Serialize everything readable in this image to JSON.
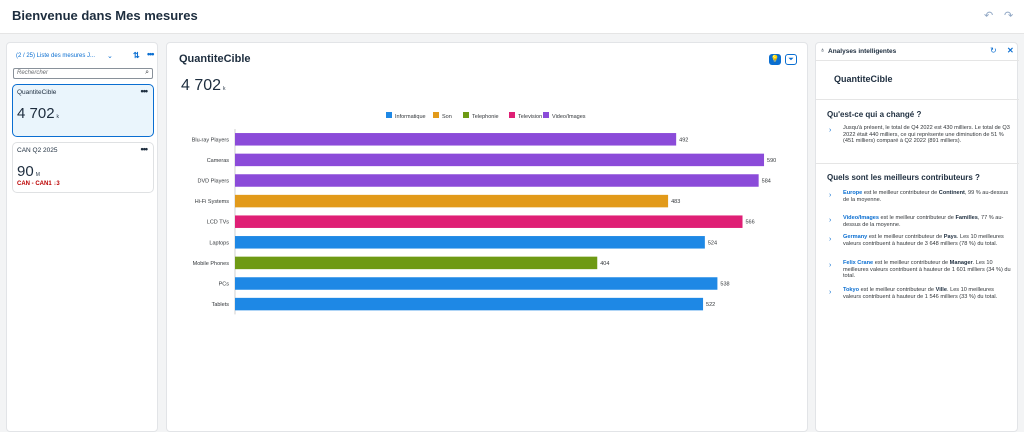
{
  "header": {
    "title": "Bienvenue dans Mes mesures"
  },
  "list": {
    "title": "(2 / 25) Liste des mesures J...",
    "search_placeholder": "Rechercher",
    "cards": [
      {
        "name": "QuantiteCible",
        "value": "4 702",
        "unit": "k"
      },
      {
        "name": "CAN Q2 2025",
        "value": "90",
        "unit": "M",
        "delta_label": "CAN - CAN1",
        "delta_value": "3"
      }
    ]
  },
  "main": {
    "title": "QuantiteCible",
    "value": "4 702",
    "unit": "k"
  },
  "chart_data": {
    "type": "bar",
    "orientation": "horizontal",
    "categories": [
      "Blu-ray Players",
      "Cameras",
      "DVD Players",
      "Hi-Fi Systems",
      "LCD TVs",
      "Laptops",
      "Mobile Phones",
      "PCs",
      "Tablets"
    ],
    "values": [
      492,
      590,
      584,
      483,
      566,
      524,
      404,
      538,
      522
    ],
    "category_groups": [
      "Video/Images",
      "Video/Images",
      "Video/Images",
      "Son",
      "Television",
      "Informatique",
      "Telephonie",
      "Informatique",
      "Informatique"
    ],
    "legend": [
      {
        "name": "Informatique",
        "color": "#1e88e5"
      },
      {
        "name": "Son",
        "color": "#e29a1a"
      },
      {
        "name": "Telephonie",
        "color": "#6e9a14"
      },
      {
        "name": "Television",
        "color": "#df1f75"
      },
      {
        "name": "Video/Images",
        "color": "#8b4bd9"
      }
    ],
    "legend_position": "top",
    "xlim": [
      0,
      600
    ]
  },
  "insights": {
    "panel_title": "Analyses intelligentes",
    "measure": "QuantiteCible",
    "changed_heading": "Qu'est-ce qui a changé ?",
    "changed_text": "Jusqu'à présent, le total de Q4 2022 est 430 milliers. Le total de Q3 2022 était 440 milliers, ce qui représente une diminution de 51 % (451 milliers) comparé à Q2 2022 (891 milliers).",
    "contrib_heading": "Quels sont les meilleurs contributeurs ?",
    "contributors": [
      {
        "name": "Europe",
        "text": " est le meilleur contributeur de ",
        "dim": "Continent",
        "rest": ", 99 % au-dessus de la moyenne."
      },
      {
        "name": "Video/Images",
        "text": " est le meilleur contributeur de ",
        "dim": "Familles",
        "rest": ", 77 % au-dessus de la moyenne."
      },
      {
        "name": "Germany",
        "text": " est le meilleur contributeur de ",
        "dim": "Pays",
        "rest": ". Les 10 meilleures valeurs contribuent à hauteur de 3 648 milliers (78 %) du total."
      },
      {
        "name": "Felix Crane",
        "text": " est le meilleur contributeur de ",
        "dim": "Manager",
        "rest": ". Les 10 meilleures valeurs contribuent à hauteur de 1 601 milliers (34 %) du total."
      },
      {
        "name": "Tokyo",
        "text": " est le meilleur contributeur de ",
        "dim": "Ville",
        "rest": ". Les 10 meilleures valeurs contribuent à hauteur de 1 546 milliers (33 %) du total."
      }
    ]
  }
}
